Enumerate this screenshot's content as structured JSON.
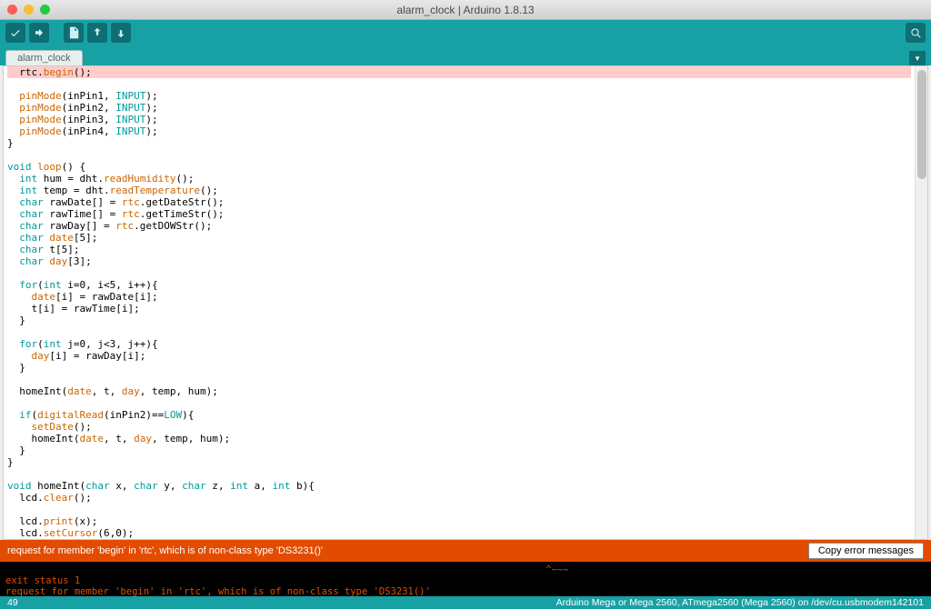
{
  "window": {
    "title": "alarm_clock | Arduino 1.8.13"
  },
  "tabs": {
    "active": "alarm_clock"
  },
  "error_bar": {
    "message": "request for member 'begin' in 'rtc', which is of non-class type 'DS3231()'",
    "copy_label": "Copy error messages"
  },
  "console": {
    "line1": "exit status 1",
    "line2": "request for member 'begin' in 'rtc', which is of non-class type 'DS3231()'",
    "caret": "                                                                                              ^~~~"
  },
  "status": {
    "line": "49",
    "board": "Arduino Mega or Mega 2560, ATmega2560 (Mega 2560) on /dev/cu.usbmodem142101"
  },
  "code": {
    "l1a": "  rtc.",
    "l1b": "begin",
    "l1c": "();",
    "blank1": "",
    "l2a": "  ",
    "l2b": "pinMode",
    "l2c": "(inPin1, ",
    "l2d": "INPUT",
    "l2e": ");",
    "l3a": "  ",
    "l3b": "pinMode",
    "l3c": "(inPin2, ",
    "l3d": "INPUT",
    "l3e": ");",
    "l4a": "  ",
    "l4b": "pinMode",
    "l4c": "(inPin3, ",
    "l4d": "INPUT",
    "l4e": ");",
    "l5a": "  ",
    "l5b": "pinMode",
    "l5c": "(inPin4, ",
    "l5d": "INPUT",
    "l5e": ");",
    "l6": "}",
    "blank2": "",
    "l7a": "void",
    "l7b": " ",
    "l7c": "loop",
    "l7d": "() {",
    "l8a": "  ",
    "l8b": "int",
    "l8c": " hum = dht.",
    "l8d": "readHumidity",
    "l8e": "();",
    "l9a": "  ",
    "l9b": "int",
    "l9c": " temp = dht.",
    "l9d": "readTemperature",
    "l9e": "();",
    "l10a": "  ",
    "l10b": "char",
    "l10c": " rawDate[] = ",
    "l10d": "rtc",
    "l10e": ".getDateStr();",
    "l11a": "  ",
    "l11b": "char",
    "l11c": " rawTime[] = ",
    "l11d": "rtc",
    "l11e": ".getTimeStr();",
    "l12a": "  ",
    "l12b": "char",
    "l12c": " rawDay[] = ",
    "l12d": "rtc",
    "l12e": ".getDOWStr();",
    "l13a": "  ",
    "l13b": "char",
    "l13c": " ",
    "l13d": "date",
    "l13e": "[5];",
    "l14a": "  ",
    "l14b": "char",
    "l14c": " t[5];",
    "l15a": "  ",
    "l15b": "char",
    "l15c": " ",
    "l15d": "day",
    "l15e": "[3];",
    "blank3": "",
    "l16a": "  ",
    "l16b": "for",
    "l16c": "(",
    "l16d": "int",
    "l16e": " i=0, i<5, i++){",
    "l17a": "    ",
    "l17b": "date",
    "l17c": "[i] = rawDate[i];",
    "l18": "    t[i] = rawTime[i];",
    "l19": "  }",
    "blank4": "",
    "l20a": "  ",
    "l20b": "for",
    "l20c": "(",
    "l20d": "int",
    "l20e": " j=0, j<3, j++){",
    "l21a": "    ",
    "l21b": "day",
    "l21c": "[i] = rawDay[i];",
    "l22": "  }",
    "blank5": "",
    "l23a": "  homeInt(",
    "l23b": "date",
    "l23c": ", t, ",
    "l23d": "day",
    "l23e": ", temp, hum);",
    "blank6": "",
    "l24a": "  ",
    "l24b": "if",
    "l24c": "(",
    "l24d": "digitalRead",
    "l24e": "(inPin2)==",
    "l24f": "LOW",
    "l24g": "){",
    "l25a": "    ",
    "l25b": "setDate",
    "l25c": "();",
    "l26a": "    homeInt(",
    "l26b": "date",
    "l26c": ", t, ",
    "l26d": "day",
    "l26e": ", temp, hum);",
    "l27": "  }",
    "l28": "}",
    "blank7": "",
    "l29a": "void",
    "l29b": " homeInt(",
    "l29c": "char",
    "l29d": " x, ",
    "l29e": "char",
    "l29f": " y, ",
    "l29g": "char",
    "l29h": " z, ",
    "l29i": "int",
    "l29j": " a, ",
    "l29k": "int",
    "l29l": " b){",
    "l30a": "  lcd.",
    "l30b": "clear",
    "l30c": "();",
    "blank8": "",
    "l31a": "  lcd.",
    "l31b": "print",
    "l31c": "(x);",
    "l32a": "  lcd.",
    "l32b": "setCursor",
    "l32c": "(6,0);"
  }
}
